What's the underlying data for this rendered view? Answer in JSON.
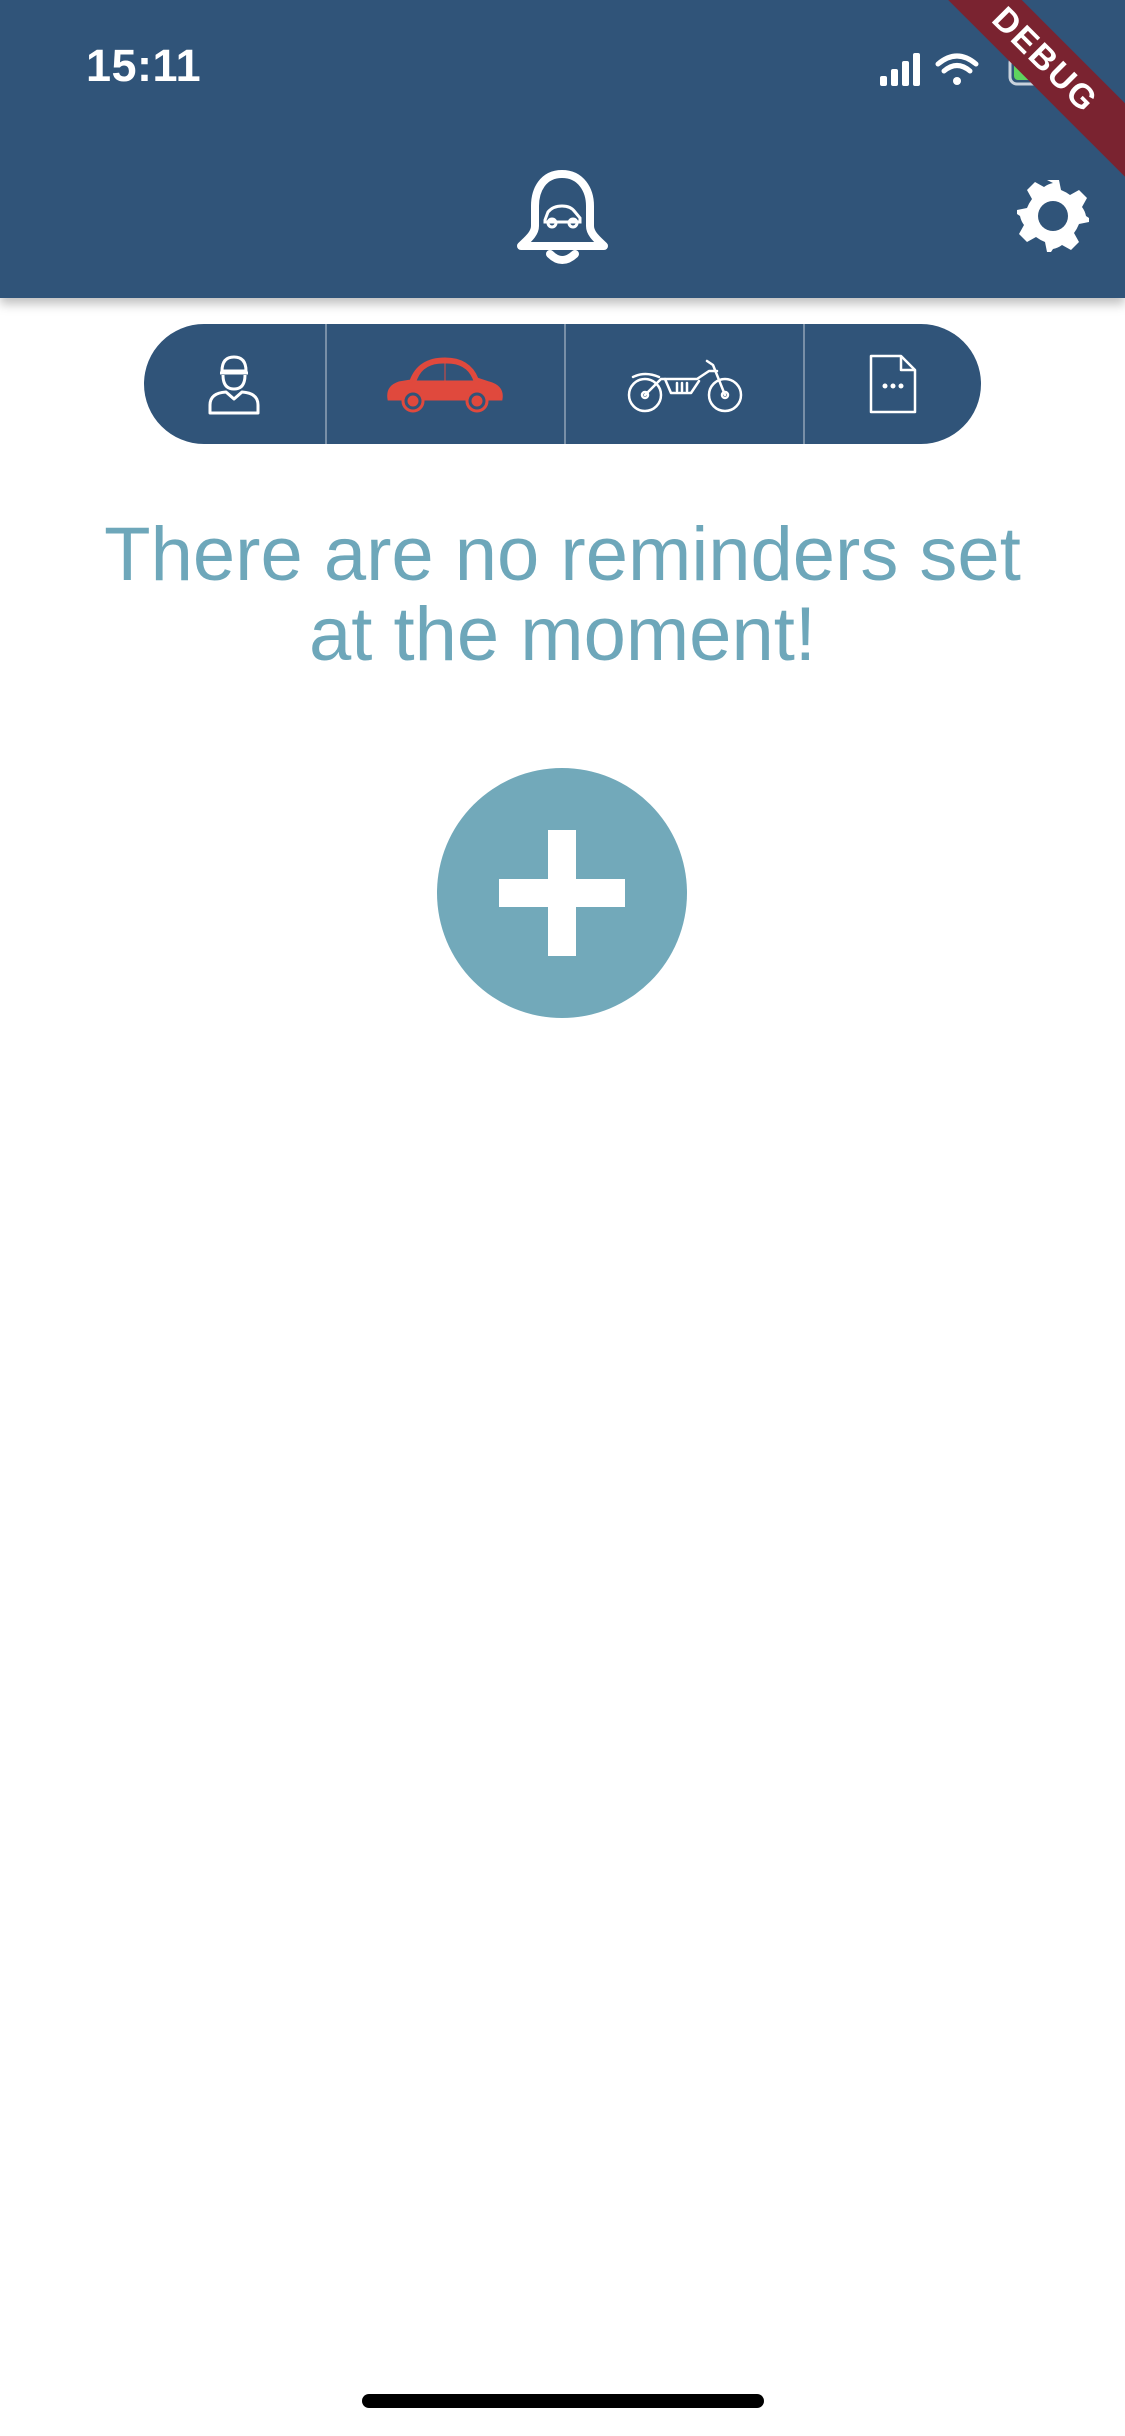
{
  "status_bar": {
    "time": "15:11",
    "icons": [
      "signal-icon",
      "wifi-icon",
      "battery-icon"
    ]
  },
  "header": {
    "icon": "bell-car-icon",
    "settings_icon": "gear-icon",
    "debug_label": "DEBUG",
    "color": "#305479"
  },
  "tabs": [
    {
      "icon": "person-icon",
      "selected": false
    },
    {
      "icon": "car-icon",
      "selected": true
    },
    {
      "icon": "motorcycle-icon",
      "selected": false
    },
    {
      "icon": "document-icon",
      "selected": false
    }
  ],
  "colors": {
    "selected_tab_icon": "#e0493d",
    "accent": "#72a9ba",
    "text": "#6ea7ba"
  },
  "main": {
    "empty_message_line1": "There are no reminders set",
    "empty_message_line2": "at the moment!",
    "add_icon": "plus-icon"
  }
}
